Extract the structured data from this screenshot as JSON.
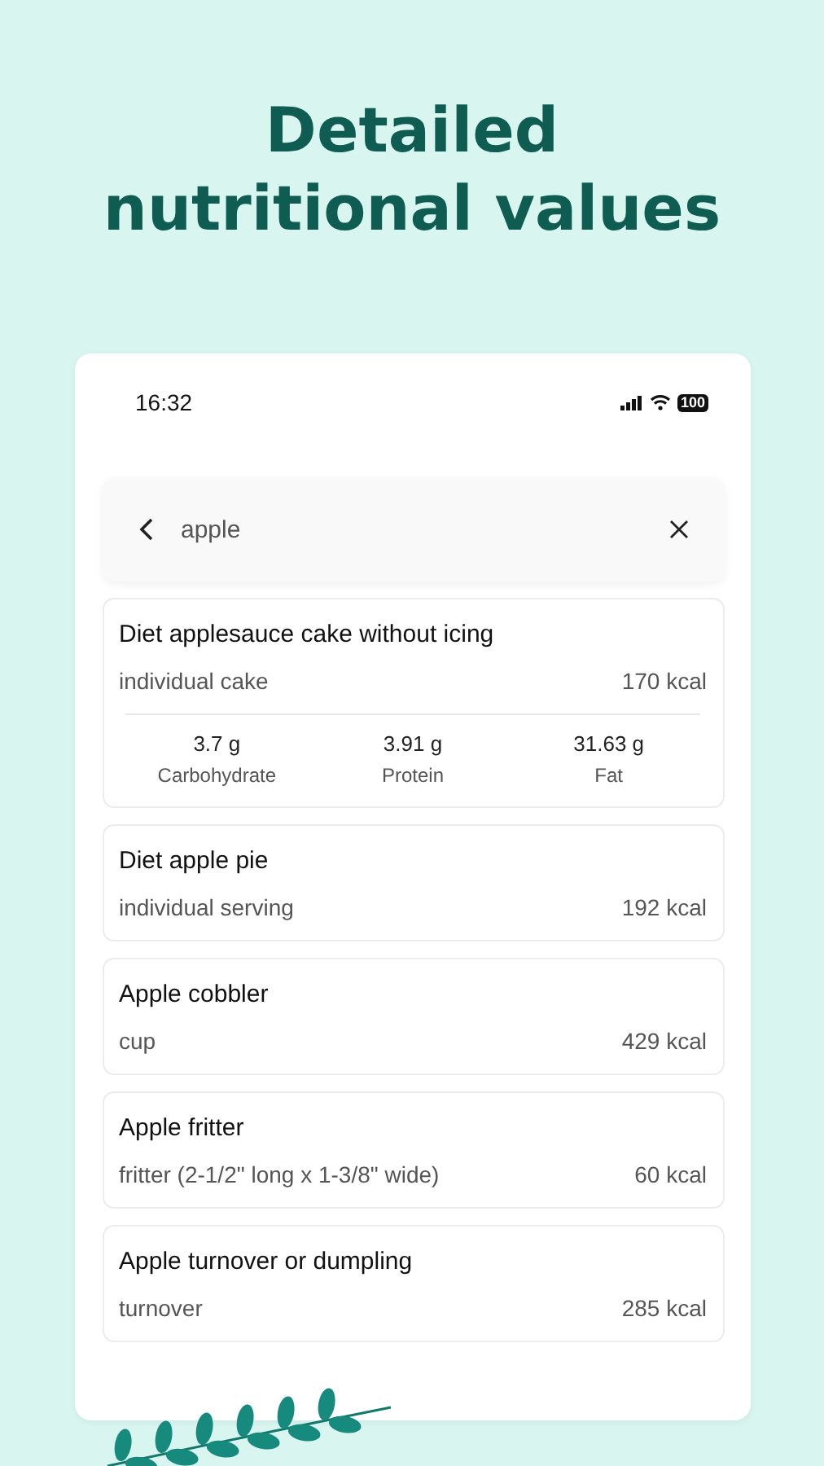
{
  "headline": [
    "Detailed",
    "nutritional values"
  ],
  "status_bar": {
    "time": "16:32",
    "battery": "100"
  },
  "search": {
    "value": "apple"
  },
  "results": [
    {
      "name": "Diet applesauce cake without icing",
      "serving": "individual cake",
      "kcal": "170 kcal",
      "macros": [
        {
          "value": "3.7 g",
          "label": "Carbohydrate"
        },
        {
          "value": "3.91 g",
          "label": "Protein"
        },
        {
          "value": "31.63 g",
          "label": "Fat"
        }
      ]
    },
    {
      "name": "Diet apple pie",
      "serving": "individual serving",
      "kcal": "192 kcal"
    },
    {
      "name": "Apple cobbler",
      "serving": "cup",
      "kcal": "429 kcal"
    },
    {
      "name": "Apple fritter",
      "serving": "fritter (2-1/2\" long x 1-3/8\" wide)",
      "kcal": "60 kcal"
    },
    {
      "name": "Apple turnover or dumpling",
      "serving": "turnover",
      "kcal": "285 kcal"
    }
  ]
}
